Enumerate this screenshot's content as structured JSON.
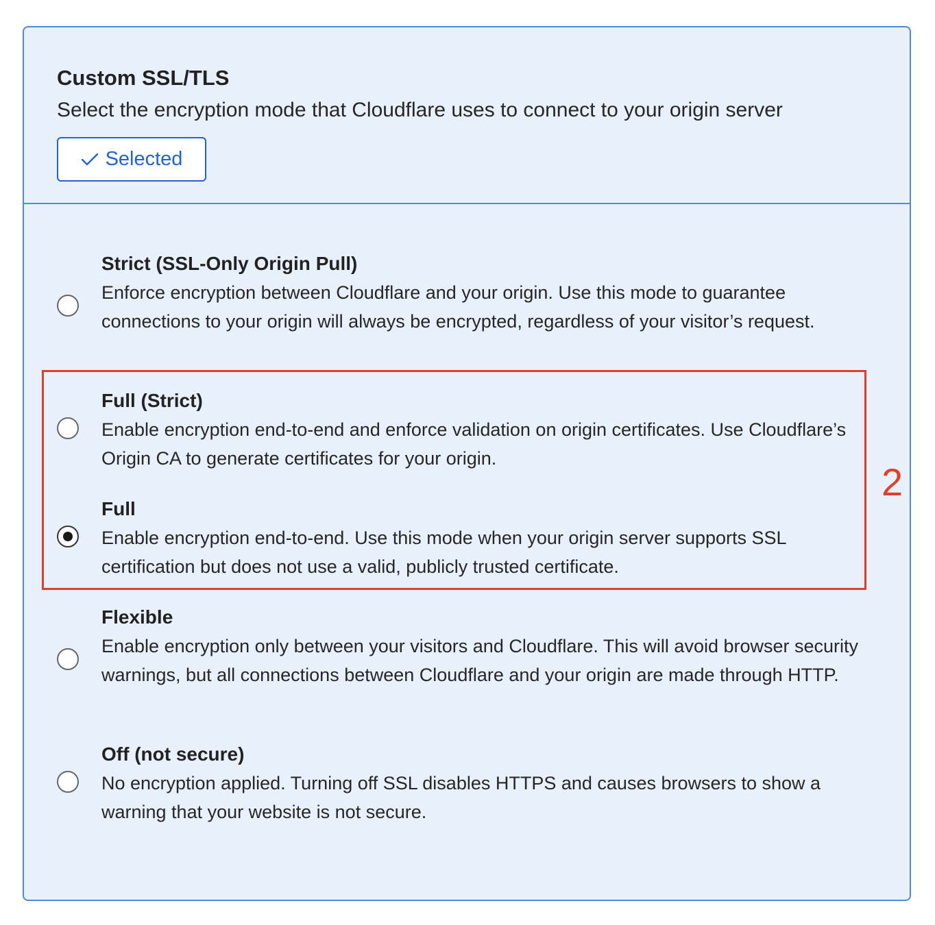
{
  "header": {
    "title": "Custom SSL/TLS",
    "subtitle": "Select the encryption mode that Cloudflare uses to connect to your origin server",
    "selected_button": {
      "icon": "check-icon",
      "label": "Selected"
    }
  },
  "options": [
    {
      "title": "Strict (SSL-Only Origin Pull)",
      "description": "Enforce encryption between Cloudflare and your origin. Use this mode to guarantee connections to your origin will always be encrypted, regardless of your visitor’s request.",
      "checked": false
    },
    {
      "title": "Full (Strict)",
      "description": "Enable encryption end-to-end and enforce validation on origin certificates. Use Cloudflare’s Origin CA to generate certificates for your origin.",
      "checked": false
    },
    {
      "title": "Full",
      "description": "Enable encryption end-to-end. Use this mode when your origin server supports SSL certification but does not use a valid, publicly trusted certificate.",
      "checked": true
    },
    {
      "title": "Flexible",
      "description": "Enable encryption only between your visitors and Cloudflare. This will avoid browser security warnings, but all connections between Cloudflare and your origin are made through HTTP.",
      "checked": false
    },
    {
      "title": "Off (not secure)",
      "description": "No encryption applied. Turning off SSL disables HTTPS and causes browsers to show a warning that your website is not secure.",
      "checked": false
    }
  ],
  "annotation": {
    "number": "2",
    "color": "#e0402a"
  },
  "colors": {
    "accent": "#1f63d6",
    "card_background": "#e8f0fb",
    "card_border": "#4a8ae0"
  }
}
